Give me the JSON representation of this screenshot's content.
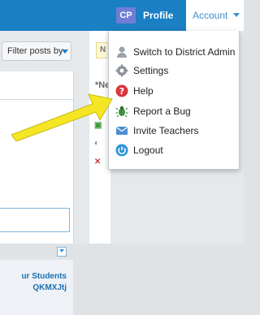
{
  "header": {
    "avatar_initials": "CP",
    "profile_label": "Profile",
    "account_label": "Account"
  },
  "toolbar": {
    "filter_label": "Filter posts by",
    "note_prefix": "N",
    "new_label": "*Ne"
  },
  "class_card": {
    "line1": "ur Students",
    "line2": "QKMXJtj"
  },
  "account_menu": {
    "items": [
      {
        "label": "Switch to District Admin",
        "icon": "user-silhouette-icon"
      },
      {
        "label": "Settings",
        "icon": "gear-icon"
      },
      {
        "label": "Help",
        "icon": "help-icon"
      },
      {
        "label": "Report a Bug",
        "icon": "bug-icon"
      },
      {
        "label": "Invite Teachers",
        "icon": "envelope-icon"
      },
      {
        "label": "Logout",
        "icon": "power-icon"
      }
    ]
  },
  "colors": {
    "header_blue": "#1b7fc4",
    "help_red": "#d9363e",
    "arrow_yellow": "#f5e625"
  }
}
